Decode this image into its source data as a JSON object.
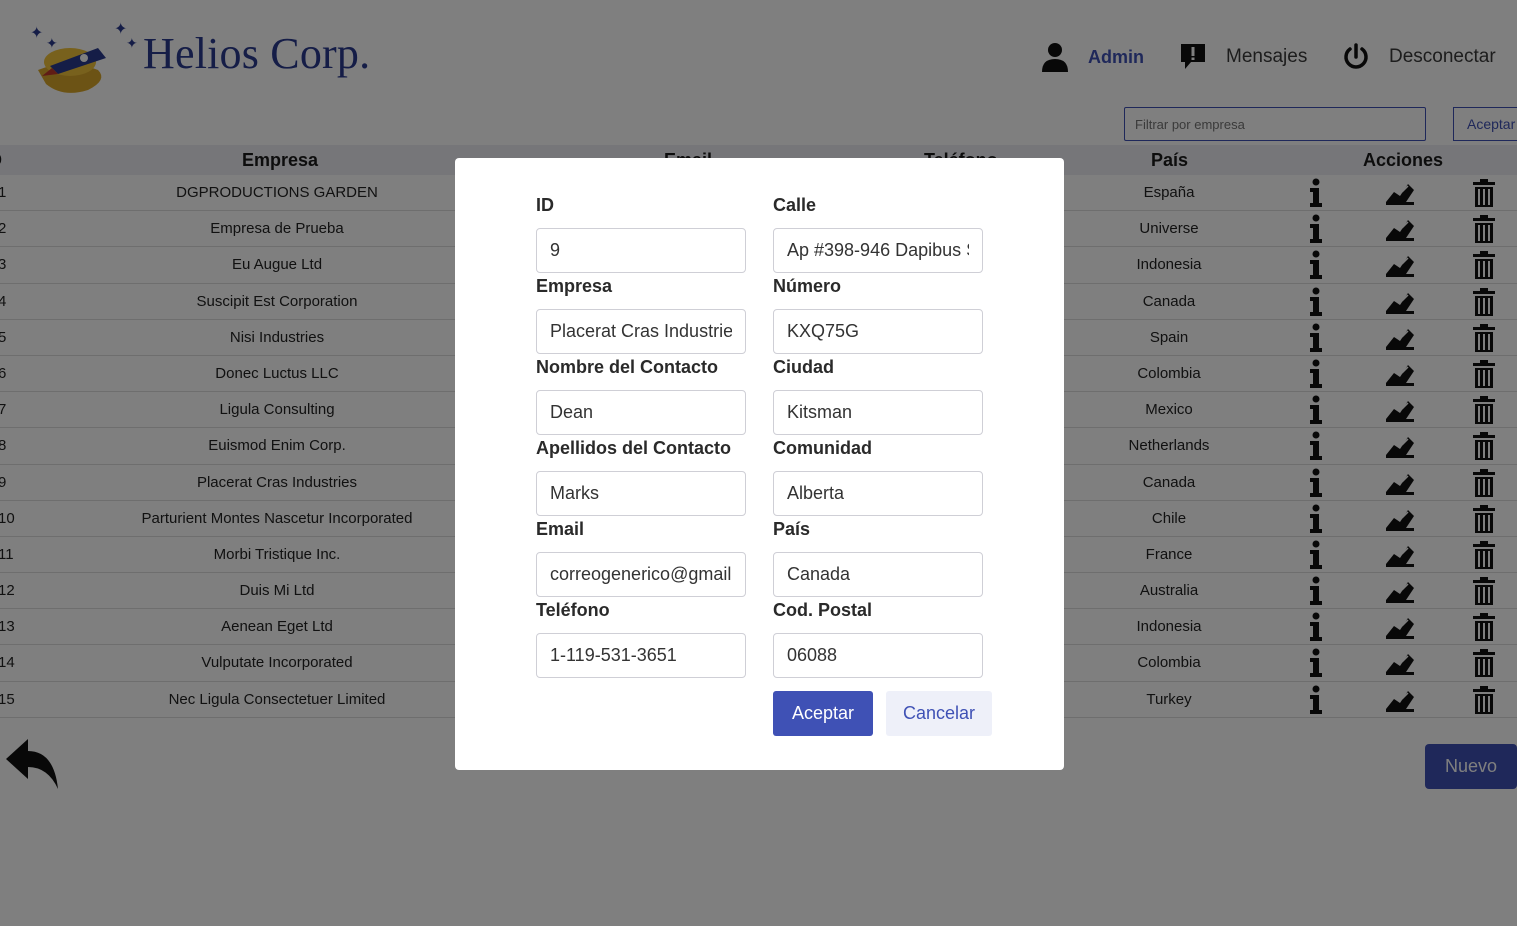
{
  "header": {
    "brand": "Helios Corp.",
    "nav": {
      "admin": "Admin",
      "messages": "Mensajes",
      "logout": "Desconectar"
    },
    "filter_placeholder": "Filtrar por empresa",
    "filter_button": "Aceptar"
  },
  "table": {
    "columns": {
      "id": "ID",
      "empresa": "Empresa",
      "email": "Email",
      "telefono": "Teléfono",
      "pais": "País",
      "acciones": "Acciones"
    },
    "rows": [
      {
        "id": "1",
        "empresa": "DGPRODUCTIONS GARDEN",
        "pais": "España"
      },
      {
        "id": "2",
        "empresa": "Empresa de Prueba",
        "pais": "Universe"
      },
      {
        "id": "3",
        "empresa": "Eu Augue Ltd",
        "pais": "Indonesia"
      },
      {
        "id": "4",
        "empresa": "Suscipit Est Corporation",
        "pais": "Canada"
      },
      {
        "id": "5",
        "empresa": "Nisi Industries",
        "pais": "Spain"
      },
      {
        "id": "6",
        "empresa": "Donec Luctus LLC",
        "pais": "Colombia"
      },
      {
        "id": "7",
        "empresa": "Ligula Consulting",
        "pais": "Mexico"
      },
      {
        "id": "8",
        "empresa": "Euismod Enim Corp.",
        "pais": "Netherlands"
      },
      {
        "id": "9",
        "empresa": "Placerat Cras Industries",
        "pais": "Canada"
      },
      {
        "id": "10",
        "empresa": "Parturient Montes Nascetur Incorporated",
        "pais": "Chile"
      },
      {
        "id": "11",
        "empresa": "Morbi Tristique Inc.",
        "pais": "France"
      },
      {
        "id": "12",
        "empresa": "Duis Mi Ltd",
        "pais": "Australia"
      },
      {
        "id": "13",
        "empresa": "Aenean Eget Ltd",
        "pais": "Indonesia"
      },
      {
        "id": "14",
        "empresa": "Vulputate Incorporated",
        "pais": "Colombia"
      },
      {
        "id": "15",
        "empresa": "Nec Ligula Consectetuer Limited",
        "pais": "Turkey"
      }
    ]
  },
  "nuevo_button": "Nuevo",
  "modal": {
    "labels": {
      "id": "ID",
      "calle": "Calle",
      "empresa": "Empresa",
      "numero": "Número",
      "nombre": "Nombre del Contacto",
      "ciudad": "Ciudad",
      "apellidos": "Apellidos del Contacto",
      "comunidad": "Comunidad",
      "email": "Email",
      "pais": "País",
      "telefono": "Teléfono",
      "cod_postal": "Cod. Postal"
    },
    "values": {
      "id": "9",
      "calle": "Ap #398-946 Dapibus S",
      "empresa": "Placerat Cras Industries",
      "numero": "KXQ75G",
      "nombre": "Dean",
      "ciudad": "Kitsman",
      "apellidos": "Marks",
      "comunidad": "Alberta",
      "email": "correogenerico@gmail",
      "pais": "Canada",
      "telefono": "1-119-531-3651",
      "cod_postal": "06088"
    },
    "accept": "Aceptar",
    "cancel": "Cancelar"
  },
  "colors": {
    "primary": "#3f51b5",
    "overlay": "rgba(0,0,0,0.5)"
  }
}
